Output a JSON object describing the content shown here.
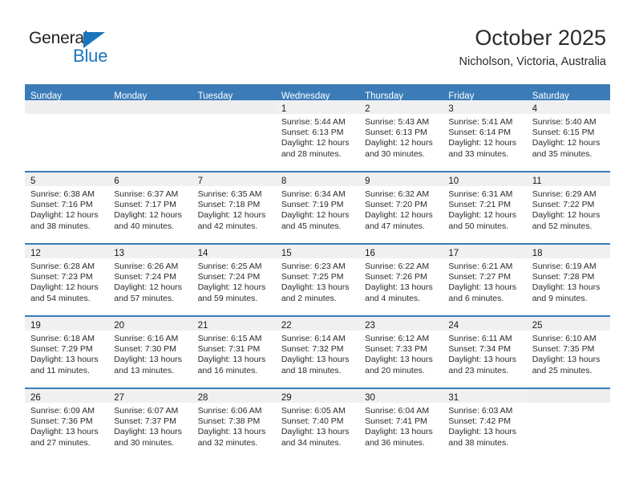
{
  "brand": {
    "name_top": "General",
    "name_bottom": "Blue",
    "accent_color": "#1a74bb"
  },
  "header": {
    "title": "October 2025",
    "subtitle": "Nicholson, Victoria, Australia"
  },
  "theme": {
    "header_blue": "#3b7cb8",
    "daynum_band": "#f0f0f0",
    "text": "#2a2a2a"
  },
  "calendar": {
    "weekday_headers": [
      "Sunday",
      "Monday",
      "Tuesday",
      "Wednesday",
      "Thursday",
      "Friday",
      "Saturday"
    ],
    "weeks": [
      [
        {
          "day": "",
          "lines": []
        },
        {
          "day": "",
          "lines": []
        },
        {
          "day": "",
          "lines": []
        },
        {
          "day": "1",
          "lines": [
            "Sunrise: 5:44 AM",
            "Sunset: 6:13 PM",
            "Daylight: 12 hours",
            "and 28 minutes."
          ]
        },
        {
          "day": "2",
          "lines": [
            "Sunrise: 5:43 AM",
            "Sunset: 6:13 PM",
            "Daylight: 12 hours",
            "and 30 minutes."
          ]
        },
        {
          "day": "3",
          "lines": [
            "Sunrise: 5:41 AM",
            "Sunset: 6:14 PM",
            "Daylight: 12 hours",
            "and 33 minutes."
          ]
        },
        {
          "day": "4",
          "lines": [
            "Sunrise: 5:40 AM",
            "Sunset: 6:15 PM",
            "Daylight: 12 hours",
            "and 35 minutes."
          ]
        }
      ],
      [
        {
          "day": "5",
          "lines": [
            "Sunrise: 6:38 AM",
            "Sunset: 7:16 PM",
            "Daylight: 12 hours",
            "and 38 minutes."
          ]
        },
        {
          "day": "6",
          "lines": [
            "Sunrise: 6:37 AM",
            "Sunset: 7:17 PM",
            "Daylight: 12 hours",
            "and 40 minutes."
          ]
        },
        {
          "day": "7",
          "lines": [
            "Sunrise: 6:35 AM",
            "Sunset: 7:18 PM",
            "Daylight: 12 hours",
            "and 42 minutes."
          ]
        },
        {
          "day": "8",
          "lines": [
            "Sunrise: 6:34 AM",
            "Sunset: 7:19 PM",
            "Daylight: 12 hours",
            "and 45 minutes."
          ]
        },
        {
          "day": "9",
          "lines": [
            "Sunrise: 6:32 AM",
            "Sunset: 7:20 PM",
            "Daylight: 12 hours",
            "and 47 minutes."
          ]
        },
        {
          "day": "10",
          "lines": [
            "Sunrise: 6:31 AM",
            "Sunset: 7:21 PM",
            "Daylight: 12 hours",
            "and 50 minutes."
          ]
        },
        {
          "day": "11",
          "lines": [
            "Sunrise: 6:29 AM",
            "Sunset: 7:22 PM",
            "Daylight: 12 hours",
            "and 52 minutes."
          ]
        }
      ],
      [
        {
          "day": "12",
          "lines": [
            "Sunrise: 6:28 AM",
            "Sunset: 7:23 PM",
            "Daylight: 12 hours",
            "and 54 minutes."
          ]
        },
        {
          "day": "13",
          "lines": [
            "Sunrise: 6:26 AM",
            "Sunset: 7:24 PM",
            "Daylight: 12 hours",
            "and 57 minutes."
          ]
        },
        {
          "day": "14",
          "lines": [
            "Sunrise: 6:25 AM",
            "Sunset: 7:24 PM",
            "Daylight: 12 hours",
            "and 59 minutes."
          ]
        },
        {
          "day": "15",
          "lines": [
            "Sunrise: 6:23 AM",
            "Sunset: 7:25 PM",
            "Daylight: 13 hours",
            "and 2 minutes."
          ]
        },
        {
          "day": "16",
          "lines": [
            "Sunrise: 6:22 AM",
            "Sunset: 7:26 PM",
            "Daylight: 13 hours",
            "and 4 minutes."
          ]
        },
        {
          "day": "17",
          "lines": [
            "Sunrise: 6:21 AM",
            "Sunset: 7:27 PM",
            "Daylight: 13 hours",
            "and 6 minutes."
          ]
        },
        {
          "day": "18",
          "lines": [
            "Sunrise: 6:19 AM",
            "Sunset: 7:28 PM",
            "Daylight: 13 hours",
            "and 9 minutes."
          ]
        }
      ],
      [
        {
          "day": "19",
          "lines": [
            "Sunrise: 6:18 AM",
            "Sunset: 7:29 PM",
            "Daylight: 13 hours",
            "and 11 minutes."
          ]
        },
        {
          "day": "20",
          "lines": [
            "Sunrise: 6:16 AM",
            "Sunset: 7:30 PM",
            "Daylight: 13 hours",
            "and 13 minutes."
          ]
        },
        {
          "day": "21",
          "lines": [
            "Sunrise: 6:15 AM",
            "Sunset: 7:31 PM",
            "Daylight: 13 hours",
            "and 16 minutes."
          ]
        },
        {
          "day": "22",
          "lines": [
            "Sunrise: 6:14 AM",
            "Sunset: 7:32 PM",
            "Daylight: 13 hours",
            "and 18 minutes."
          ]
        },
        {
          "day": "23",
          "lines": [
            "Sunrise: 6:12 AM",
            "Sunset: 7:33 PM",
            "Daylight: 13 hours",
            "and 20 minutes."
          ]
        },
        {
          "day": "24",
          "lines": [
            "Sunrise: 6:11 AM",
            "Sunset: 7:34 PM",
            "Daylight: 13 hours",
            "and 23 minutes."
          ]
        },
        {
          "day": "25",
          "lines": [
            "Sunrise: 6:10 AM",
            "Sunset: 7:35 PM",
            "Daylight: 13 hours",
            "and 25 minutes."
          ]
        }
      ],
      [
        {
          "day": "26",
          "lines": [
            "Sunrise: 6:09 AM",
            "Sunset: 7:36 PM",
            "Daylight: 13 hours",
            "and 27 minutes."
          ]
        },
        {
          "day": "27",
          "lines": [
            "Sunrise: 6:07 AM",
            "Sunset: 7:37 PM",
            "Daylight: 13 hours",
            "and 30 minutes."
          ]
        },
        {
          "day": "28",
          "lines": [
            "Sunrise: 6:06 AM",
            "Sunset: 7:38 PM",
            "Daylight: 13 hours",
            "and 32 minutes."
          ]
        },
        {
          "day": "29",
          "lines": [
            "Sunrise: 6:05 AM",
            "Sunset: 7:40 PM",
            "Daylight: 13 hours",
            "and 34 minutes."
          ]
        },
        {
          "day": "30",
          "lines": [
            "Sunrise: 6:04 AM",
            "Sunset: 7:41 PM",
            "Daylight: 13 hours",
            "and 36 minutes."
          ]
        },
        {
          "day": "31",
          "lines": [
            "Sunrise: 6:03 AM",
            "Sunset: 7:42 PM",
            "Daylight: 13 hours",
            "and 38 minutes."
          ]
        },
        {
          "day": "",
          "lines": []
        }
      ]
    ]
  }
}
